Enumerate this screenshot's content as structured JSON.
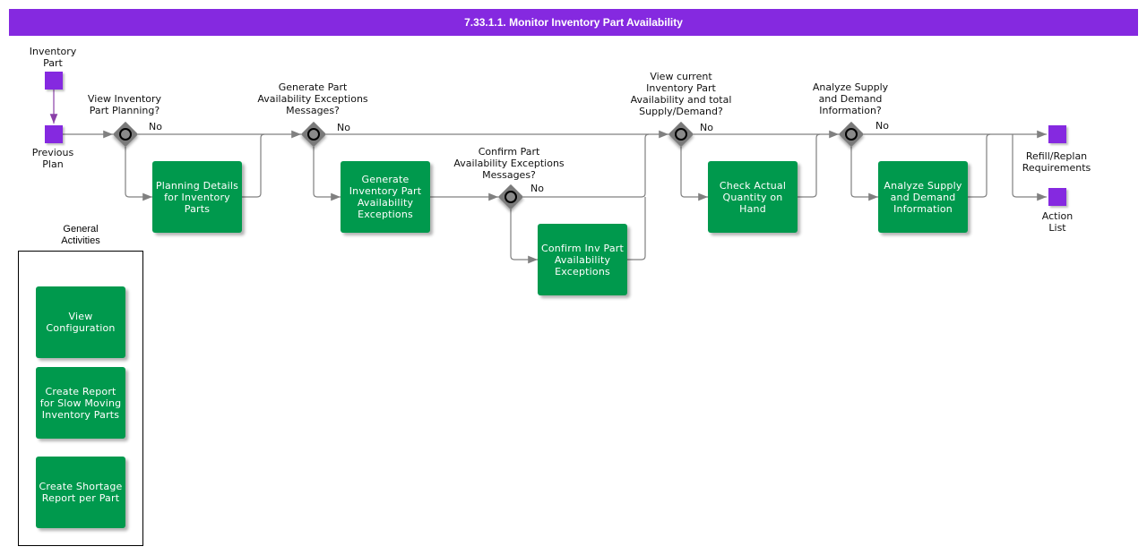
{
  "title": "7.33.1.1. Monitor Inventory Part Availability",
  "colors": {
    "header": "#8529e0",
    "task": "#00994d",
    "event": "#8529e0",
    "gateway": "#7a7a7a",
    "flow": "#808080",
    "association": "#8a3fa8"
  },
  "events": {
    "inventory_part": "Inventory\nPart",
    "previous_plan": "Previous\nPlan",
    "refill_replan": "Refill/Replan\nRequirements",
    "action_list": "Action\nList"
  },
  "gateways": [
    {
      "id": "g1",
      "question": "View Inventory\nPart Planning?",
      "no_label": "No"
    },
    {
      "id": "g2",
      "question": "Generate Part\nAvailability Exceptions\nMessages?",
      "no_label": "No"
    },
    {
      "id": "g3",
      "question": "Confirm Part\nAvailability Exceptions\nMessages?",
      "no_label": "No"
    },
    {
      "id": "g4",
      "question": "View current\nInventory Part\nAvailability and total\nSupply/Demand?",
      "no_label": "No"
    },
    {
      "id": "g5",
      "question": "Analyze Supply\nand Demand\nInformation?",
      "no_label": "No"
    }
  ],
  "tasks": [
    {
      "id": "t1",
      "label": "Planning Details for Inventory Parts"
    },
    {
      "id": "t2",
      "label": "Generate Inventory Part Availability Exceptions"
    },
    {
      "id": "t3",
      "label": "Confirm Inv Part Availability Exceptions"
    },
    {
      "id": "t4",
      "label": "Check Actual Quantity on Hand"
    },
    {
      "id": "t5",
      "label": "Analyze Supply and Demand Information"
    }
  ],
  "general_activities": {
    "title": "General\nActivities",
    "items": [
      {
        "label": "View Configuration"
      },
      {
        "label": "Create Report for Slow Moving Inventory Parts"
      },
      {
        "label": "Create Shortage Report per Part"
      }
    ]
  }
}
